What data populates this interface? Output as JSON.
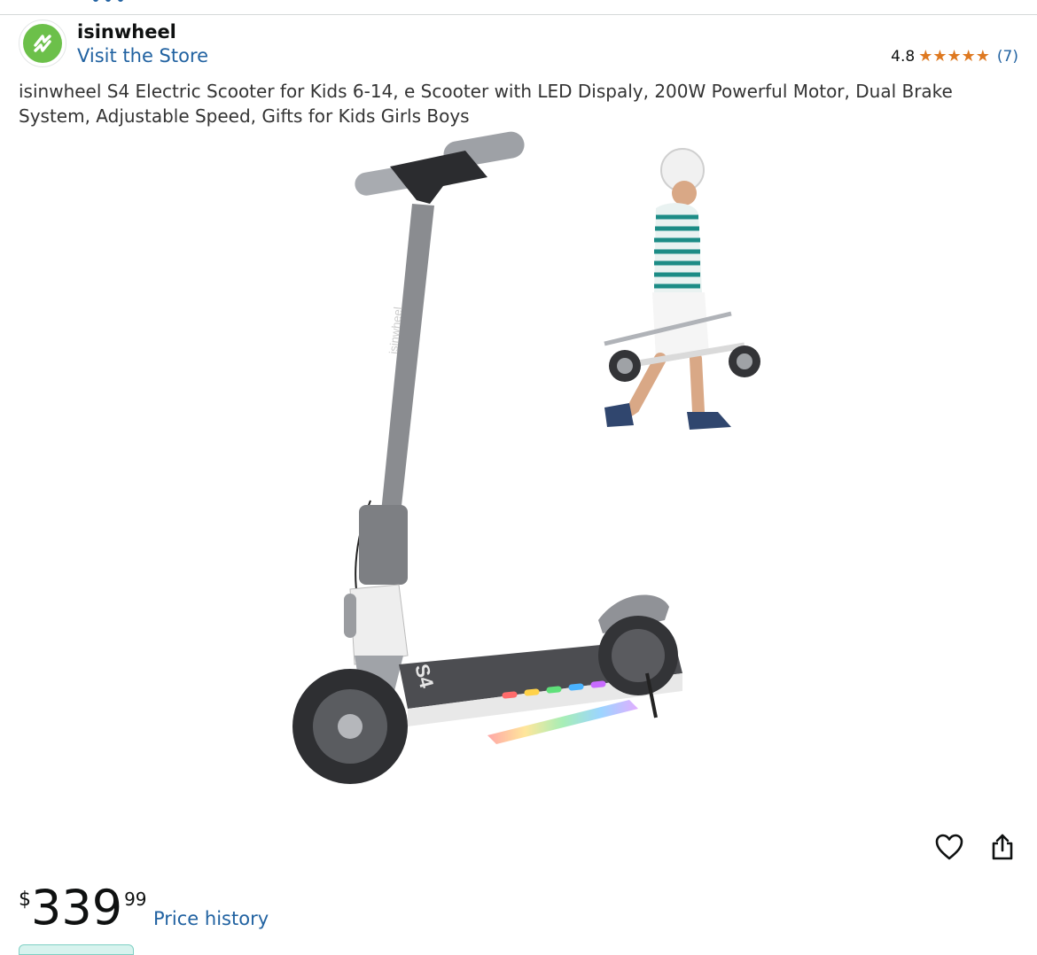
{
  "store": {
    "name": "isinwheel",
    "visit_label": "Visit the Store",
    "logo_color": "#6cc04a"
  },
  "rating": {
    "value": "4.8",
    "stars": 4.8,
    "count": "(7)",
    "star_color": "#de7921"
  },
  "product": {
    "title": "isinwheel S4 Electric Scooter for Kids 6-14, e Scooter with LED Dispaly, 200W Powerful Motor, Dual Brake System, Adjustable Speed, Gifts for Kids Girls Boys",
    "image_alt": "isinwheel S4 kids electric scooter with LED deck lights and child carrying folded scooter",
    "deck_label": "S4"
  },
  "price": {
    "symbol": "$",
    "whole": "339",
    "fraction": "99"
  },
  "links": {
    "price_history": "Price history"
  },
  "icons": {
    "wishlist": "heart-icon",
    "share": "share-icon"
  },
  "colors": {
    "link": "#2162a1",
    "text": "#0f1111",
    "scooter_gray": "#8a8c90"
  }
}
